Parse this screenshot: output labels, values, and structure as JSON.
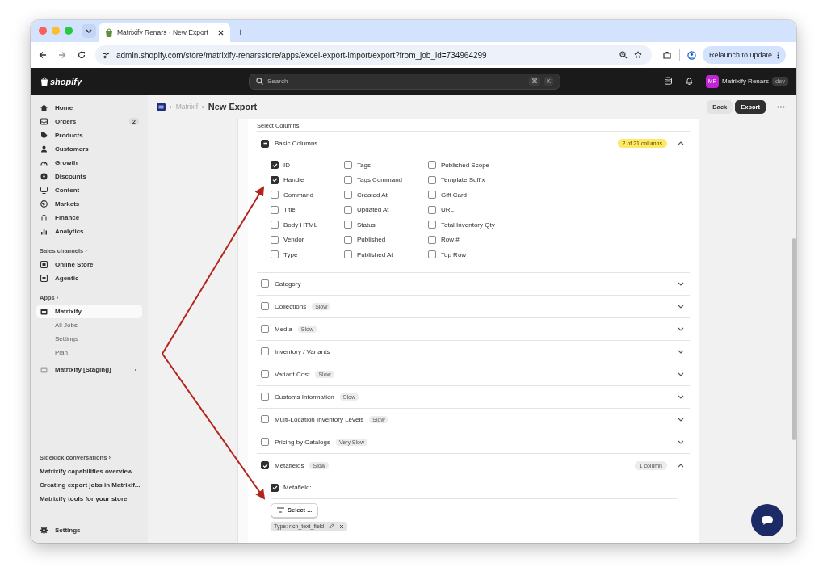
{
  "browser": {
    "tab_title": "Matrixify Renars · New Export",
    "url": "admin.shopify.com/store/matrixify-renarsstore/apps/excel-export-import/export?from_job_id=734964299",
    "relaunch_button": "Relaunch to update",
    "new_tab": "+"
  },
  "topbar": {
    "logo": "shopify",
    "search_placeholder": "Search",
    "shortcut": [
      "⌘",
      "K"
    ],
    "avatar": "MR",
    "store_name": "Matrixify Renars",
    "store_badge": "dev"
  },
  "sidebar": {
    "items": [
      {
        "label": "Home"
      },
      {
        "label": "Orders",
        "badge": "2"
      },
      {
        "label": "Products"
      },
      {
        "label": "Customers"
      },
      {
        "label": "Growth"
      },
      {
        "label": "Discounts"
      },
      {
        "label": "Content"
      },
      {
        "label": "Markets"
      },
      {
        "label": "Finance"
      },
      {
        "label": "Analytics"
      }
    ],
    "channels_heading": "Sales channels ›",
    "channels": [
      {
        "label": "Online Store"
      },
      {
        "label": "Agentic"
      }
    ],
    "apps_heading": "Apps ›",
    "apps": [
      {
        "label": "Matrixify",
        "selected": true,
        "children": [
          {
            "label": "All Jobs"
          },
          {
            "label": "Settings"
          },
          {
            "label": "Plan"
          }
        ]
      },
      {
        "label": "Matrixify [Staging]",
        "selected": false
      }
    ],
    "conversations_heading": "Sidekick conversations ›",
    "conversations": [
      "Matrixify capabilities overview",
      "Creating export jobs in Matrixif...",
      "Matrixify tools for your store"
    ],
    "settings": "Settings"
  },
  "header": {
    "separators": [
      "›",
      "›"
    ],
    "breadcrumb": "Matrixif",
    "title": "New Export",
    "back_button": "Back",
    "export_button": "Export"
  },
  "section_title": "Select Columns",
  "groups": [
    {
      "label": "Basic Columns",
      "checked": false,
      "partial": true,
      "expanded": true,
      "count": {
        "text": "2 of 21 columns",
        "highlighted": true
      },
      "columns": [
        [
          {
            "label": "ID",
            "checked": true
          },
          {
            "label": "Handle",
            "checked": true
          },
          {
            "label": "Command",
            "checked": false
          },
          {
            "label": "Title",
            "checked": false
          },
          {
            "label": "Body HTML",
            "checked": false
          },
          {
            "label": "Vendor",
            "checked": false
          },
          {
            "label": "Type",
            "checked": false
          }
        ],
        [
          {
            "label": "Tags",
            "checked": false
          },
          {
            "label": "Tags Command",
            "checked": false
          },
          {
            "label": "Created At",
            "checked": false
          },
          {
            "label": "Updated At",
            "checked": false
          },
          {
            "label": "Status",
            "checked": false
          },
          {
            "label": "Published",
            "checked": false
          },
          {
            "label": "Published At",
            "checked": false
          }
        ],
        [
          {
            "label": "Published Scope",
            "checked": false
          },
          {
            "label": "Template Suffix",
            "checked": false
          },
          {
            "label": "Gift Card",
            "checked": false
          },
          {
            "label": "URL",
            "checked": false
          },
          {
            "label": "Total Inventory Qty",
            "checked": false
          },
          {
            "label": "Row #",
            "checked": false
          },
          {
            "label": "Top Row",
            "checked": false
          }
        ]
      ]
    },
    {
      "label": "Category",
      "checked": false,
      "partial": false,
      "expanded": false
    },
    {
      "label": "Collections",
      "checked": false,
      "partial": false,
      "expanded": false,
      "speed": "Slow"
    },
    {
      "label": "Media",
      "checked": false,
      "partial": false,
      "expanded": false,
      "speed": "Slow"
    },
    {
      "label": "Inventory / Variants",
      "checked": false,
      "partial": false,
      "expanded": false
    },
    {
      "label": "Variant Cost",
      "checked": false,
      "partial": false,
      "expanded": false,
      "speed": "Slow"
    },
    {
      "label": "Customs Information",
      "checked": false,
      "partial": false,
      "expanded": false,
      "speed": "Slow"
    },
    {
      "label": "Multi-Location Inventory Levels",
      "checked": false,
      "partial": false,
      "expanded": false,
      "speed": "Slow"
    },
    {
      "label": "Pricing by Catalogs",
      "checked": false,
      "partial": false,
      "expanded": false,
      "speed": "Very Slow"
    },
    {
      "label": "Metafields",
      "checked": true,
      "partial": false,
      "expanded": true,
      "speed": "Slow",
      "count": {
        "text": "1 column",
        "highlighted": false
      },
      "metafields": [
        {
          "label": "Metafield: ...",
          "checked": true
        }
      ],
      "select_button": "Select ...",
      "filter_tag": "Type: rich_text_field"
    }
  ]
}
